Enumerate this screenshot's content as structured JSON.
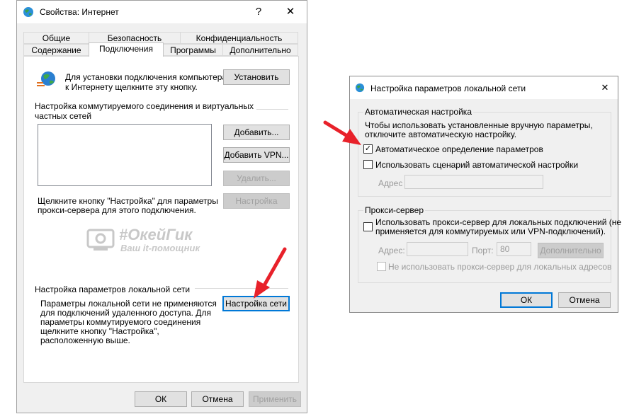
{
  "left": {
    "title": "Свойства: Интернет",
    "help": "?",
    "close": "✕",
    "tabs_row1": [
      "Общие",
      "Безопасность",
      "Конфиденциальность"
    ],
    "tabs_row2": [
      "Содержание",
      "Подключения",
      "Программы",
      "Дополнительно"
    ],
    "setup_text": [
      "Для установки подключения компьютера",
      "к Интернету щелкните эту кнопку."
    ],
    "setup_button": "Установить",
    "dialup_section": [
      "Настройка коммутируемого соединения и виртуальных",
      "частных сетей"
    ],
    "add_button": "Добавить...",
    "add_vpn_button": "Добавить VPN...",
    "remove_button": "Удалить...",
    "settings_button": "Настройка",
    "proxy_hint": [
      "Щелкните кнопку \"Настройка\" для параметры",
      "прокси-сервера для этого подключения."
    ],
    "lan_section": "Настройка параметров локальной сети",
    "lan_text": [
      "Параметры локальной сети не применяются",
      "для подключений удаленного доступа. Для",
      "параметры коммутируемого соединения",
      "щелкните кнопку \"Настройка\",",
      "расположенную выше."
    ],
    "lan_button": "Настройка сети",
    "ok": "ОК",
    "cancel": "Отмена",
    "apply": "Применить"
  },
  "watermark": {
    "brand": "#ОкейГик",
    "tagline": "Ваш it-помощник"
  },
  "right": {
    "title": "Настройка параметров локальной сети",
    "close": "✕",
    "auto_group": "Автоматическая настройка",
    "auto_desc": [
      "Чтобы использовать установленные вручную параметры,",
      "отключите автоматическую настройку."
    ],
    "auto_detect_label": "Автоматическое определение параметров",
    "auto_detect_checked": true,
    "auto_script_label": "Использовать сценарий автоматической настройки",
    "auto_script_checked": false,
    "address_label": "Адрес",
    "proxy_group": "Прокси-сервер",
    "use_proxy_label": [
      "Использовать прокси-сервер для локальных подключений (не",
      "применяется для коммутируемых или VPN-подключений)."
    ],
    "use_proxy_checked": false,
    "proxy_address_label": "Адрес:",
    "port_label": "Порт:",
    "port_value": "80",
    "advanced_button": "Дополнительно",
    "bypass_label": "Не использовать прокси-сервер для локальных адресов",
    "bypass_checked": false,
    "ok": "ОК",
    "cancel": "Отмена"
  },
  "colors": {
    "arrow": "#e8212a",
    "focus": "#0078d7"
  }
}
